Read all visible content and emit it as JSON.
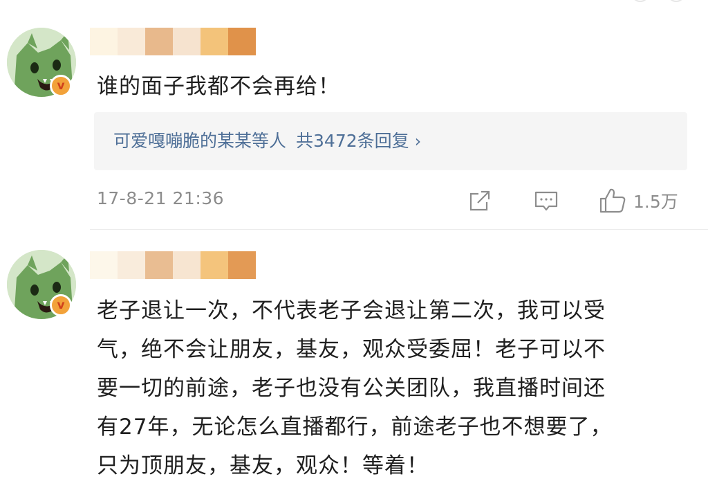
{
  "comments": [
    {
      "text": "谁的面子我都不会再给！",
      "badge": "v",
      "name_blur_colors": [
        "#fdf4e2",
        "#f9ead8",
        "#e8b98c",
        "#f6e3cf",
        "#f3c37a",
        "#e0924a"
      ],
      "reply": {
        "users": "可爱嘎嘣脆的某某等人",
        "count": "共3472条回复"
      },
      "timestamp": "17-8-21 21:36",
      "likes": "1.5万"
    },
    {
      "badge": "v",
      "name_blur_colors": [
        "#fdf7ea",
        "#f9ecdc",
        "#e9bd92",
        "#f7e5d1",
        "#f4c47c",
        "#e39a55"
      ],
      "lines": [
        "老子退让一次，不代表老子会退让第二次，我可以受",
        "气，绝不会让朋友，基友，观众受委屈！老子可以不",
        "要一切的前途，老子也没有公关团队，我直播时间还",
        "有27年，无论怎么直播都行，前途老子也不想要了，",
        "只为顶朋友，基友，观众！等着！"
      ]
    }
  ],
  "icons": {
    "avatar": "green-cat-avatar-icon",
    "verified": "verified-badge-icon",
    "share": "share-icon",
    "comment": "comment-icon",
    "like": "thumbs-up-icon",
    "chevron": "chevron-right-icon"
  },
  "colors": {
    "link": "#4e6f97",
    "meta": "#8c8c8c",
    "badge_bg": "#f2a23a",
    "badge_fg": "#d0401c",
    "avatar_green": "#6fa35c"
  }
}
